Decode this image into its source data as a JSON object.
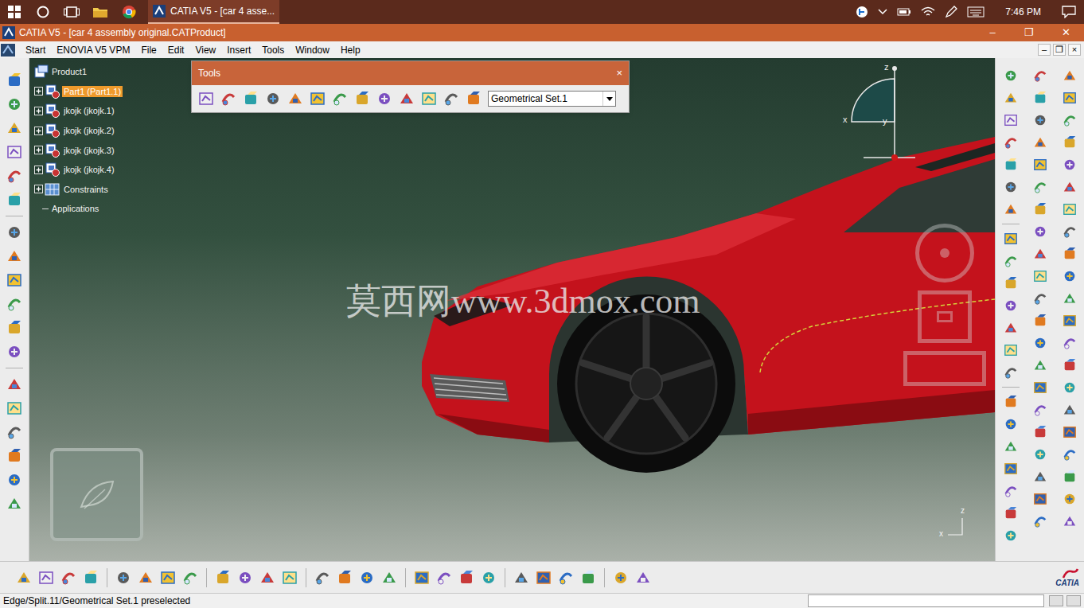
{
  "taskbar": {
    "app_tab": "CATIA V5 - [car 4 asse...",
    "time": "7:46 PM"
  },
  "window": {
    "title": "CATIA V5 - [car 4 assembly original.CATProduct]",
    "controls": [
      "–",
      "❐",
      "✕"
    ]
  },
  "menu_bar": {
    "items": [
      "Start",
      "ENOVIA V5 VPM",
      "File",
      "Edit",
      "View",
      "Insert",
      "Tools",
      "Window",
      "Help"
    ],
    "controls": [
      "–",
      "❐",
      "×"
    ]
  },
  "tree": {
    "items": [
      {
        "label": "Product1",
        "depth": 0,
        "kind": "product",
        "selected": false
      },
      {
        "label": "Part1 (Part1.1)",
        "depth": 1,
        "kind": "part",
        "expanded": false,
        "selected": true
      },
      {
        "label": "jkojk (jkojk.1)",
        "depth": 1,
        "kind": "part",
        "expanded": false,
        "selected": false
      },
      {
        "label": "jkojk (jkojk.2)",
        "depth": 1,
        "kind": "part",
        "expanded": false,
        "selected": false
      },
      {
        "label": "jkojk (jkojk.3)",
        "depth": 1,
        "kind": "part",
        "expanded": false,
        "selected": false
      },
      {
        "label": "jkojk (jkojk.4)",
        "depth": 1,
        "kind": "part",
        "expanded": false,
        "selected": false
      },
      {
        "label": "Constraints",
        "depth": 1,
        "kind": "constraints",
        "expanded": false,
        "selected": false
      },
      {
        "label": "Applications",
        "depth": 0,
        "kind": "applications",
        "selected": false
      }
    ]
  },
  "tools_toolbar": {
    "title": "Tools",
    "close": "×",
    "dropdown": {
      "value": "Geometrical Set.1"
    }
  },
  "watermark": "莫西网www.3dmox.com",
  "compass": {
    "labels": [
      "z",
      "x",
      "y"
    ]
  },
  "view_axis": {
    "labels": [
      "z",
      "x"
    ]
  },
  "logo": "CATIA",
  "status_bar": {
    "text": "Edge/Split.11/Geometrical Set.1 preselected"
  }
}
